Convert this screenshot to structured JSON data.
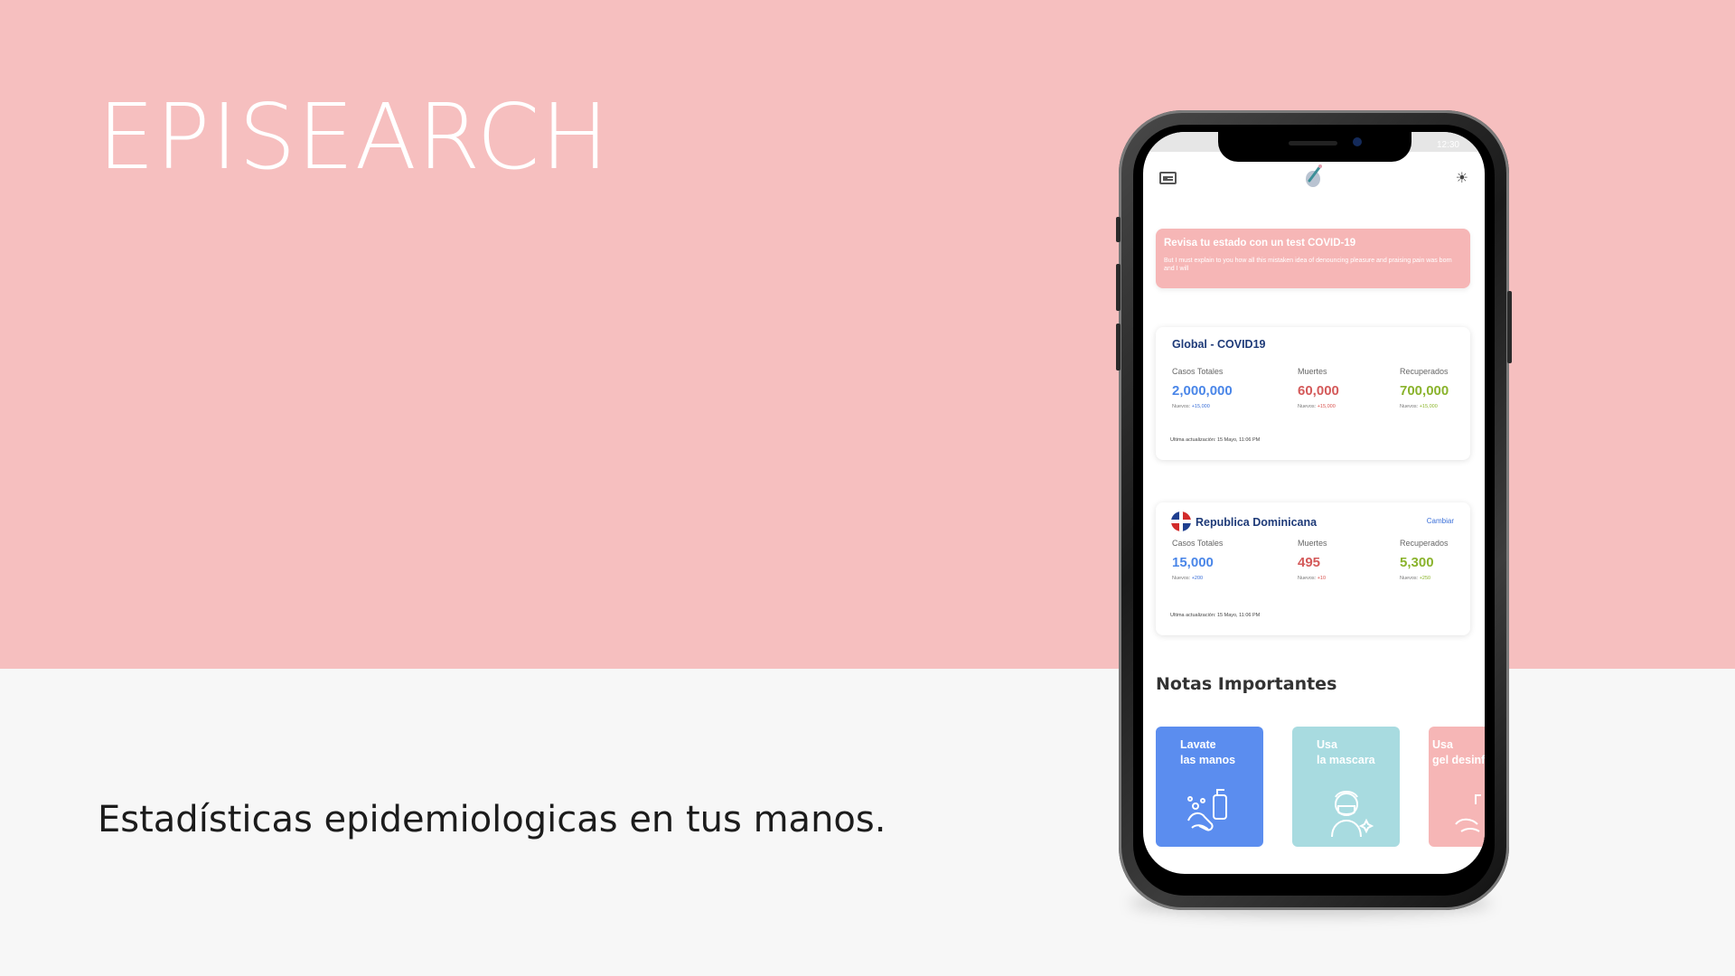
{
  "hero": {
    "title": "EPISEARCH",
    "tagline": "Estadísticas epidemiologicas en tus manos."
  },
  "status_bar": {
    "time": "12:30"
  },
  "app_header": {
    "left_icon": "id-card-icon",
    "center_icon": "app-logo-icon",
    "right_icon": "sun-icon"
  },
  "alert": {
    "title": "Revisa tu estado con un test COVID-19",
    "body": "But I must explain to you how all this mistaken idea of denouncing pleasure and praising pain was born and I will"
  },
  "global_card": {
    "title": "Global - COVID19",
    "cols": [
      {
        "label": "Casos Totales",
        "value": "2,000,000",
        "new_prefix": "Nuevos:",
        "new_value": "+15,000"
      },
      {
        "label": "Muertes",
        "value": "60,000",
        "new_prefix": "Nuevos:",
        "new_value": "+15,000"
      },
      {
        "label": "Recuperados",
        "value": "700,000",
        "new_prefix": "Nuevos:",
        "new_value": "+15,000"
      }
    ],
    "updated": "Ultima actualización: 15 Mayo, 11:06 PM"
  },
  "country_card": {
    "title": "Republica Dominicana",
    "link": "Cambiar",
    "cols": [
      {
        "label": "Casos Totales",
        "value": "15,000",
        "new_prefix": "Nuevos:",
        "new_value": "+200"
      },
      {
        "label": "Muertes",
        "value": "495",
        "new_prefix": "Nuevos:",
        "new_value": "+10"
      },
      {
        "label": "Recuperados",
        "value": "5,300",
        "new_prefix": "Nuevos:",
        "new_value": "+250"
      }
    ],
    "updated": "Ultima actualización: 15 Mayo, 11:06 PM"
  },
  "notes": {
    "title": "Notas Importantes",
    "items": [
      {
        "label": "Lavate\nlas manos",
        "color": "#5b8def",
        "icon": "hand-wash-icon"
      },
      {
        "label": "Usa\nla mascara",
        "color": "#a8dbe0",
        "icon": "face-mask-icon"
      },
      {
        "label": "Usa\ngel desinf",
        "color": "#f6b6b6",
        "icon": "sanitizer-icon"
      }
    ]
  },
  "colors": {
    "pink": "#f6bfbf",
    "blue": "#4a86e8",
    "red": "#d45a5a",
    "green": "#8ab32c",
    "navy": "#1e3a78"
  }
}
